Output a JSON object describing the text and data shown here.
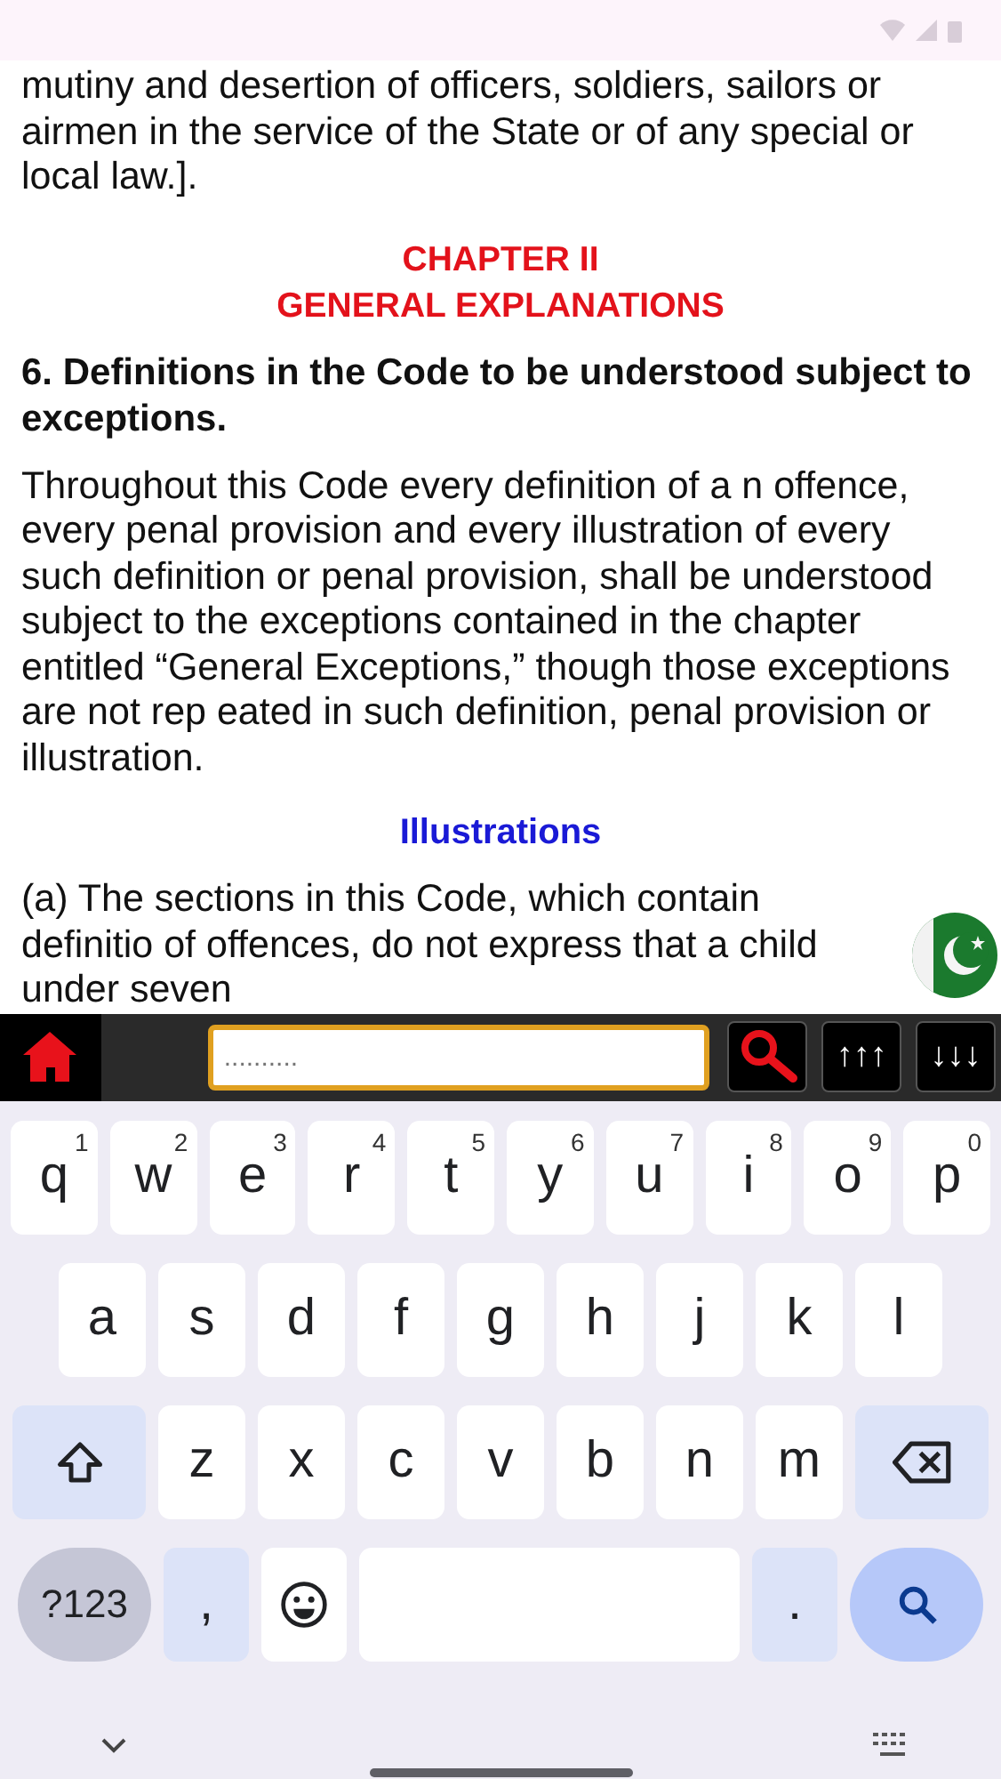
{
  "document": {
    "paragraphs": [
      {
        "kind": "body",
        "text": "mutiny and desertion of officers, soldiers, sailors or airmen in the service of the State or of any special or local law.]."
      },
      {
        "kind": "chapter",
        "lines": [
          "CHAPTER II",
          "GENERAL EXPLANATIONS"
        ]
      },
      {
        "kind": "section",
        "text": "6. Definitions in the Code to be understood subject to exceptions."
      },
      {
        "kind": "body",
        "text": "Throughout this Code every definition of a n offence, every penal provision and every illustration of every such definition or penal provision, shall be understood subject to the exceptions contained in the chapter entitled “General Exceptions,” though those exceptions are not rep eated in such definition, penal provision or illustration."
      },
      {
        "kind": "subheading",
        "text": "Illustrations"
      },
      {
        "kind": "body",
        "text": "(a) The sections in this Code, which contain definitio of offences, do not express that a child under seven"
      }
    ]
  },
  "toolbar": {
    "search_placeholder": "..........",
    "buttons": [
      {
        "kind": "search"
      },
      {
        "kind": "text",
        "label": "↑↑↑"
      },
      {
        "kind": "text",
        "label": "↓↓↓"
      }
    ]
  },
  "keyboard": {
    "rows": [
      {
        "keys": [
          {
            "kind": "letter",
            "label": "q",
            "hint": "1"
          },
          {
            "kind": "letter",
            "label": "w",
            "hint": "2"
          },
          {
            "kind": "letter",
            "label": "e",
            "hint": "3"
          },
          {
            "kind": "letter",
            "label": "r",
            "hint": "4"
          },
          {
            "kind": "letter",
            "label": "t",
            "hint": "5"
          },
          {
            "kind": "letter",
            "label": "y",
            "hint": "6"
          },
          {
            "kind": "letter",
            "label": "u",
            "hint": "7"
          },
          {
            "kind": "letter",
            "label": "i",
            "hint": "8"
          },
          {
            "kind": "letter",
            "label": "o",
            "hint": "9"
          },
          {
            "kind": "letter",
            "label": "p",
            "hint": "0"
          }
        ]
      },
      {
        "keys": [
          {
            "kind": "letter",
            "label": "a"
          },
          {
            "kind": "letter",
            "label": "s"
          },
          {
            "kind": "letter",
            "label": "d"
          },
          {
            "kind": "letter",
            "label": "f"
          },
          {
            "kind": "letter",
            "label": "g"
          },
          {
            "kind": "letter",
            "label": "h"
          },
          {
            "kind": "letter",
            "label": "j"
          },
          {
            "kind": "letter",
            "label": "k"
          },
          {
            "kind": "letter",
            "label": "l"
          }
        ]
      },
      {
        "keys": [
          {
            "kind": "shift"
          },
          {
            "kind": "letter",
            "label": "z"
          },
          {
            "kind": "letter",
            "label": "x"
          },
          {
            "kind": "letter",
            "label": "c"
          },
          {
            "kind": "letter",
            "label": "v"
          },
          {
            "kind": "letter",
            "label": "b"
          },
          {
            "kind": "letter",
            "label": "n"
          },
          {
            "kind": "letter",
            "label": "m"
          },
          {
            "kind": "backspace"
          }
        ]
      },
      {
        "keys": [
          {
            "kind": "symbols",
            "label": "?123"
          },
          {
            "kind": "punct",
            "label": ","
          },
          {
            "kind": "emoji"
          },
          {
            "kind": "space"
          },
          {
            "kind": "punct",
            "label": "."
          },
          {
            "kind": "enter"
          }
        ]
      }
    ]
  }
}
